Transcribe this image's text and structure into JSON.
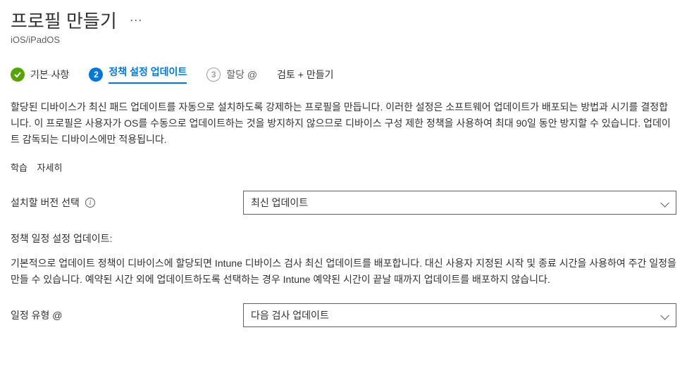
{
  "header": {
    "title": "프로필 만들기",
    "more": "···",
    "subtitle": "iOS/iPadOS"
  },
  "wizard": {
    "step1": {
      "num_check": "✓",
      "label": "기본 사항"
    },
    "step2": {
      "num": "2",
      "label": "정책 설정 업데이트"
    },
    "step3": {
      "num": "3",
      "label": "할당 @"
    },
    "step4": {
      "label": "검토 + 만들기"
    }
  },
  "description": "할당된 디바이스가 최신 패드 업데이트를 자동으로 설치하도록 강제하는 프로필을 만듭니다. 이러한 설정은 소프트웨어 업데이트가 배포되는 방법과 시기를 결정합니다. 이 프로필은 사용자가 OS를 수동으로 업데이트하는 것을 방지하지 않으므로 디바이스 구성 제한 정책을 사용하여 최대 90일 동안 방지할 수 있습니다. 업데이트 감독되는 디바이스에만 적용됩니다.",
  "learn": {
    "label": "학습",
    "link": "자세히"
  },
  "form": {
    "version_label": "설치할 버전 선택",
    "version_value": "최신 업데이트",
    "schedule_heading": "정책 일정 설정 업데이트:",
    "schedule_desc": "기본적으로 업데이트 정책이 디바이스에 할당되면 Intune 디바이스 검사 최신 업데이트를 배포합니다. 대신 사용자 지정된 시작 및 종료 시간을 사용하여 주간 일정을 만들 수 있습니다. 예약된 시간 외에 업데이트하도록 선택하는 경우 Intune 예약된 시간이 끝날 때까지 업데이트를 배포하지 않습니다.",
    "schedule_type_label": "일정 유형 @",
    "schedule_type_value": "다음 검사 업데이트"
  }
}
